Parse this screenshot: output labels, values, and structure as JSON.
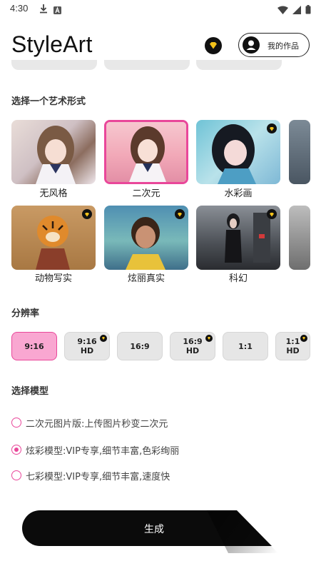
{
  "status_bar": {
    "time": "4:30"
  },
  "header": {
    "title": "StyleArt",
    "my_works_label": "我的作品"
  },
  "sections": {
    "art_form_title": "选择一个艺术形式",
    "resolution_title": "分辨率",
    "model_title": "选择模型"
  },
  "styles": [
    {
      "label": "无风格",
      "premium": false,
      "selected": false
    },
    {
      "label": "二次元",
      "premium": false,
      "selected": true
    },
    {
      "label": "水彩画",
      "premium": true,
      "selected": false
    },
    {
      "label": "动物写实",
      "premium": true,
      "selected": false
    },
    {
      "label": "炫丽真实",
      "premium": true,
      "selected": false
    },
    {
      "label": "科幻",
      "premium": true,
      "selected": false
    }
  ],
  "ratios": [
    {
      "line1": "9:16",
      "line2": "",
      "premium": false,
      "selected": true
    },
    {
      "line1": "9:16",
      "line2": "HD",
      "premium": true,
      "selected": false
    },
    {
      "line1": "16:9",
      "line2": "",
      "premium": false,
      "selected": false
    },
    {
      "line1": "16:9",
      "line2": "HD",
      "premium": true,
      "selected": false
    },
    {
      "line1": "1:1",
      "line2": "",
      "premium": false,
      "selected": false
    },
    {
      "line1": "1:1",
      "line2": "HD",
      "premium": true,
      "selected": false
    }
  ],
  "models": [
    {
      "label": "二次元图片版:上传图片秒变二次元",
      "checked": false
    },
    {
      "label": "炫彩模型:VIP专享,细节丰富,色彩绚丽",
      "checked": true
    },
    {
      "label": "七彩模型:VIP专享,细节丰富,速度快",
      "checked": false
    }
  ],
  "generate_label": "生成",
  "colors": {
    "accent": "#e9479a",
    "selected_fill": "#f9a7d1",
    "button": "#0b0b0b"
  }
}
